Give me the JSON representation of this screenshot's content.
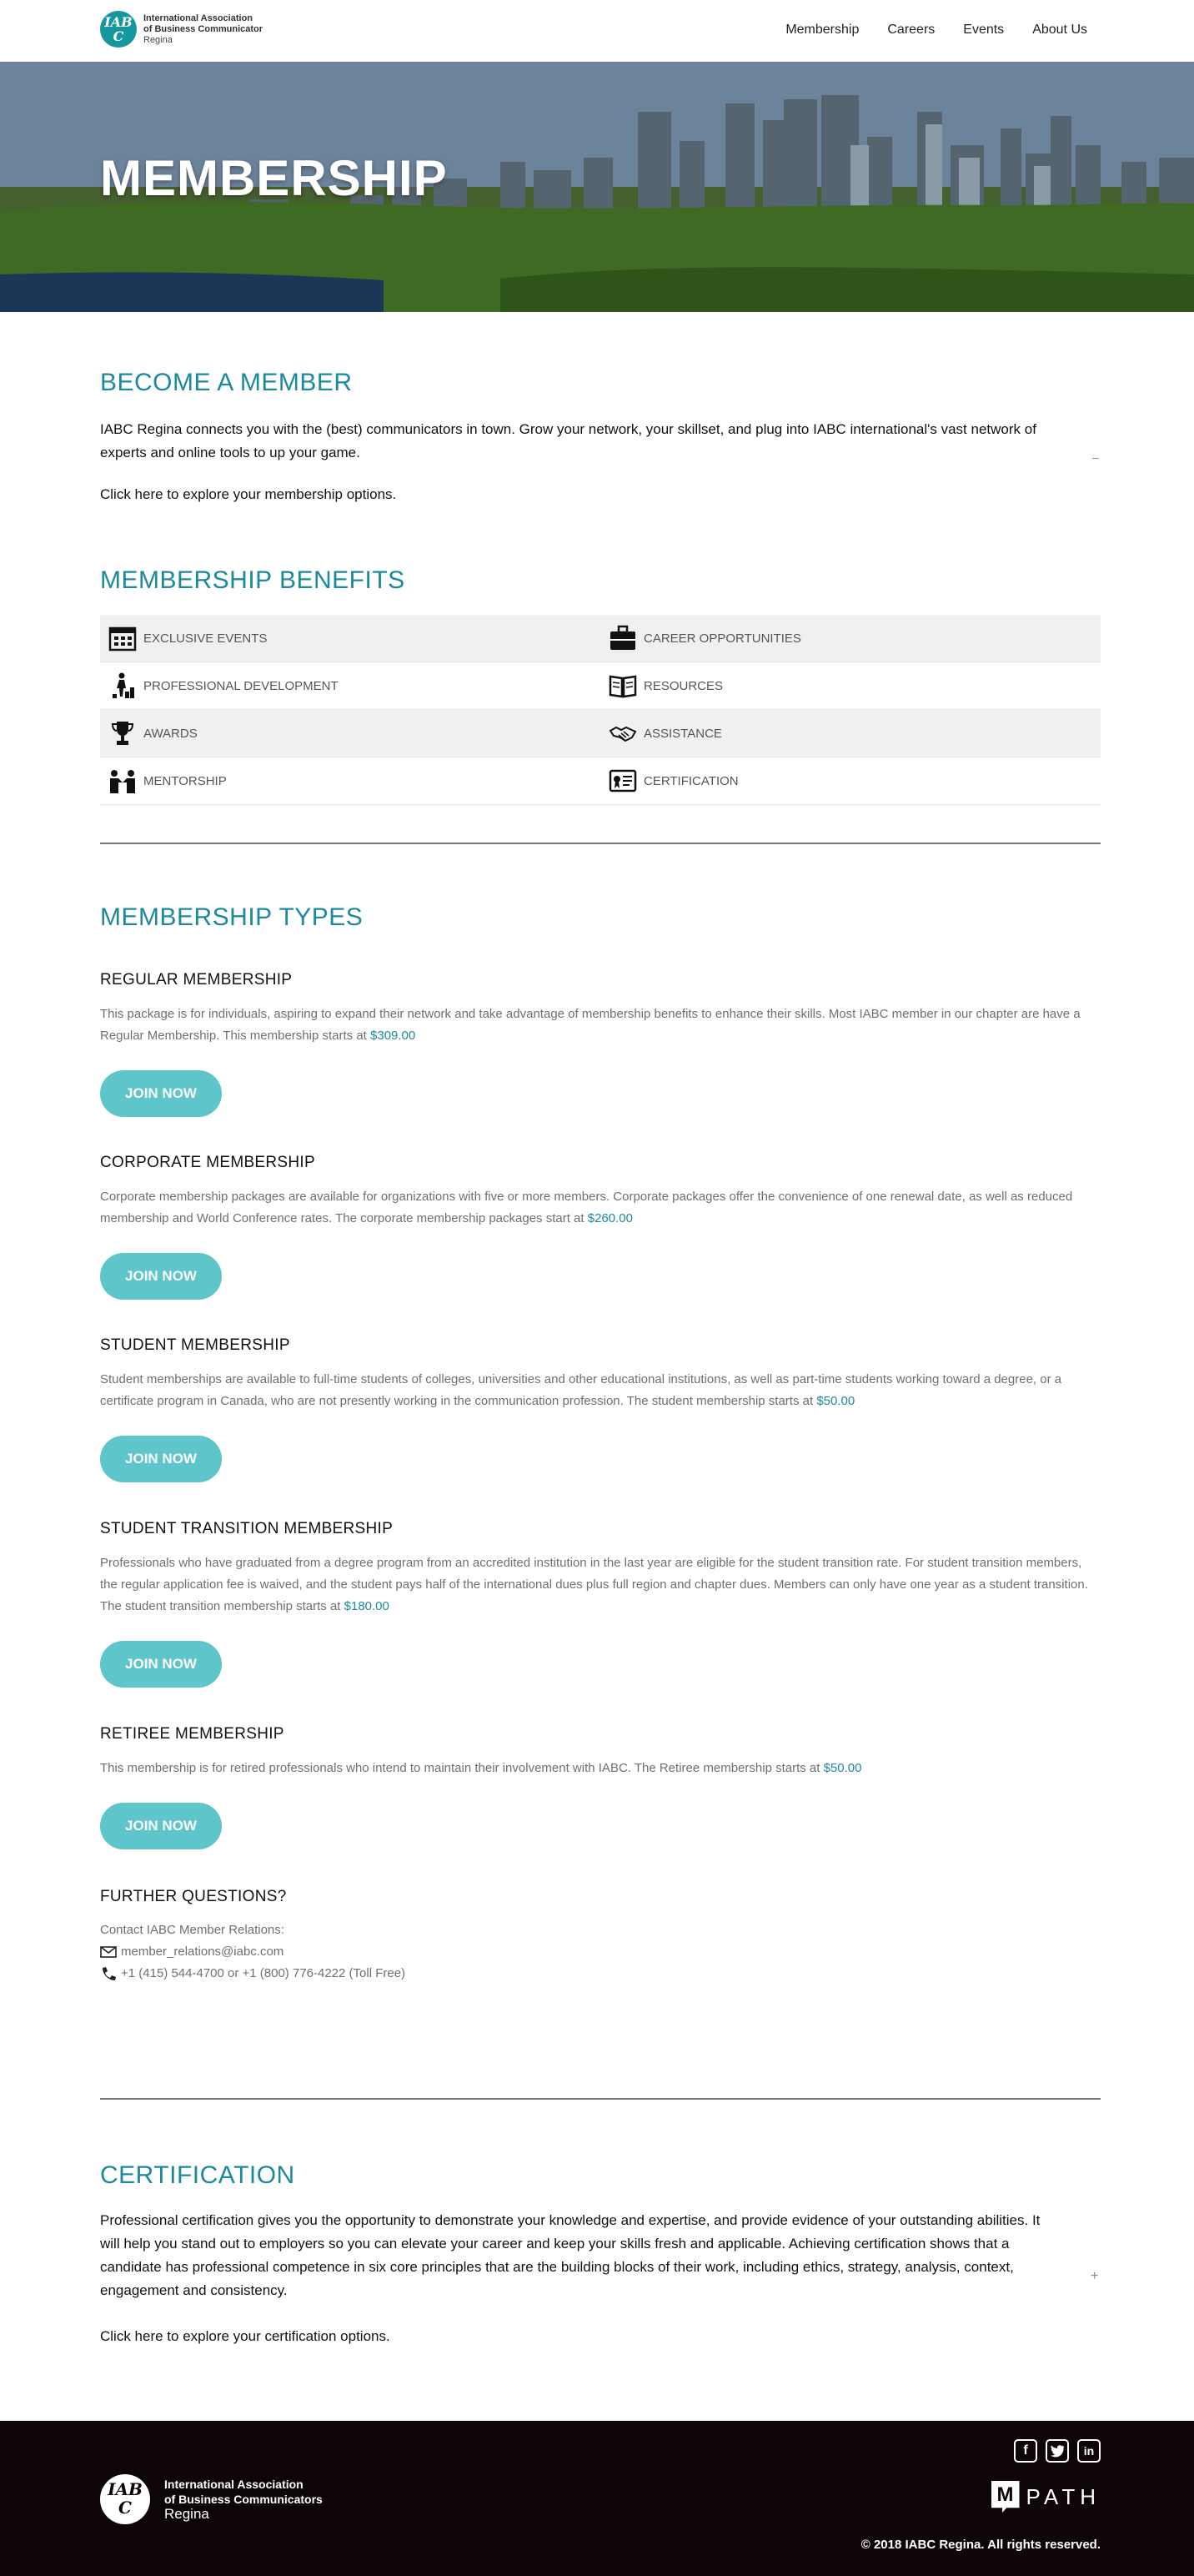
{
  "header": {
    "logo": {
      "mark": "IABC",
      "line1": "International Association",
      "line2": "of Business Communicator",
      "line3": "Regina"
    },
    "nav": [
      "Membership",
      "Careers",
      "Events",
      "About Us"
    ]
  },
  "hero": {
    "title": "MEMBERSHIP"
  },
  "become": {
    "heading": "BECOME A MEMBER",
    "text": "IABC Regina connects you with the (best) communicators in town. Grow your network, your skillset, and plug into IABC international's vast network of experts and online tools to up your game.",
    "link": "Click here to explore your membership options.",
    "toggle": "–"
  },
  "benefits": {
    "heading": "MEMBERSHIP BENEFITS",
    "items": [
      {
        "label": "Exclusive Events",
        "icon": "calendar-icon"
      },
      {
        "label": "Career Opportunities",
        "icon": "briefcase-icon"
      },
      {
        "label": "Professional Development",
        "icon": "growth-icon"
      },
      {
        "label": "Resources",
        "icon": "book-icon"
      },
      {
        "label": "Awards",
        "icon": "trophy-icon"
      },
      {
        "label": "Assistance",
        "icon": "handshake-icon"
      },
      {
        "label": "Mentorship",
        "icon": "mentorship-icon"
      },
      {
        "label": "Certification",
        "icon": "certificate-icon"
      }
    ]
  },
  "types": {
    "heading": "MEMBERSHIP TYPES",
    "join_label": "JOIN NOW",
    "list": [
      {
        "title": "REGULAR MEMBERSHIP",
        "text": "This package is for individuals, aspiring to expand their network and take advantage of membership benefits to enhance their skills. Most IABC member in our chapter are have a Regular Membership. This membership starts at",
        "price": "$309.00"
      },
      {
        "title": "CORPORATE MEMBERSHIP",
        "text": "Corporate membership packages are available for organizations with five or more members. Corporate packages offer the convenience of one renewal date, as well as reduced membership and World Conference rates. The corporate membership packages start at",
        "price": "$260.00"
      },
      {
        "title": "STUDENT MEMBERSHIP",
        "text": "Student memberships are available to full-time students of colleges, universities and other educational institutions, as well as part-time students working toward a degree, or a certificate program in Canada, who are not presently working in the communication profession. The student membership starts at",
        "price": "$50.00"
      },
      {
        "title": "STUDENT TRANSITION MEMBERSHIP",
        "text": "Professionals who have graduated from a degree program from an accredited institution in the last year are eligible for the student transition rate. For student transition members, the regular application fee is waived, and the student pays half of the international dues plus full region and chapter dues. Members can only have one year as a student transition. The student transition membership starts at",
        "price": "$180.00"
      },
      {
        "title": "RETIREE MEMBERSHIP",
        "text": "This membership is for retired professionals who intend to maintain their involvement with IABC. The Retiree membership starts at",
        "price": "$50.00"
      }
    ]
  },
  "questions": {
    "heading": "FURTHER QUESTIONS?",
    "contact_label": "Contact IABC Member Relations:",
    "email": "member_relations@iabc.com",
    "phone": "+1 (415) 544-4700 or +1 (800) 776-4222 (Toll Free)"
  },
  "certification": {
    "heading": "CERTIFICATION",
    "text": "Professional certification gives you the opportunity to demonstrate your knowledge and expertise, and provide evidence of your outstanding abilities. It will help you stand out to employers so you can elevate your career and keep your skills fresh and applicable. Achieving certification shows that a candidate has professional competence in six core principles that are the building blocks of their work, including ethics, strategy, analysis, context, engagement and consistency.",
    "link": "Click here to explore your certification options.",
    "toggle": "+"
  },
  "footer": {
    "logo": {
      "mark": "IABC",
      "line1": "International Association",
      "line2": "of Business Communicators",
      "line3": "Regina"
    },
    "social": [
      "facebook-icon",
      "twitter-icon",
      "linkedin-icon"
    ],
    "mpath": {
      "mark": "M",
      "text": "PATH"
    },
    "copyright": "© 2018 IABC Regina. All rights reserved."
  },
  "colors": {
    "accent": "#1c8a9b",
    "button": "#5ec5ca",
    "footer": "#0e0508"
  }
}
